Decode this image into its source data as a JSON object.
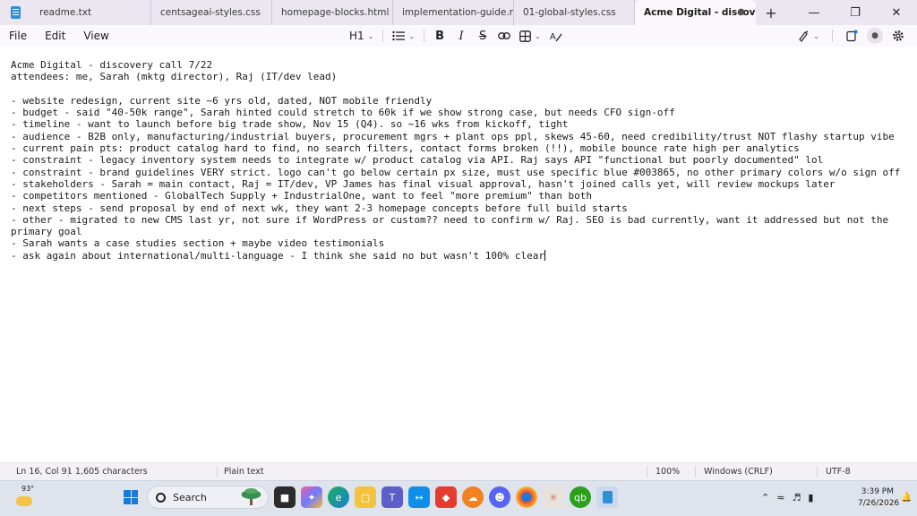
{
  "tabs": [
    {
      "label": "readme.txt",
      "active": false
    },
    {
      "label": "centsageai-styles.css",
      "active": false
    },
    {
      "label": "homepage-blocks.html",
      "active": false
    },
    {
      "label": "implementation-guide.md",
      "active": false
    },
    {
      "label": "01-global-styles.css",
      "active": false
    },
    {
      "label": "Acme Digital - discove",
      "active": true
    }
  ],
  "tab_modified_marker": "●",
  "new_tab_label": "+",
  "window_controls": {
    "minimize": "—",
    "maximize": "❐",
    "close": "✕"
  },
  "menu": {
    "file": "File",
    "edit": "Edit",
    "view": "View"
  },
  "toolbar": {
    "heading": "H1",
    "list_icon": "list-icon",
    "bold": "B",
    "italic": "I",
    "strikethrough": "S",
    "link_icon": "link-icon",
    "table_icon": "table-icon",
    "clear_format_icon": "clear-format-icon",
    "copilot_icon": "copilot-icon",
    "profile_icon": "profile-icon",
    "settings_icon": "gear-icon"
  },
  "document": {
    "lines": [
      "Acme Digital - discovery call 7/22",
      "attendees: me, Sarah (mktg director), Raj (IT/dev lead)",
      "",
      "- website redesign, current site ~6 yrs old, dated, NOT mobile friendly",
      "- budget - said \"40-50k range\", Sarah hinted could stretch to 60k if we show strong case, but needs CFO sign-off",
      "- timeline - want to launch before big trade show, Nov 15 (Q4). so ~16 wks from kickoff, tight",
      "- audience - B2B only, manufacturing/industrial buyers, procurement mgrs + plant ops ppl, skews 45-60, need credibility/trust NOT flashy startup vibe",
      "- current pain pts: product catalog hard to find, no search filters, contact forms broken (!!), mobile bounce rate high per analytics",
      "- constraint - legacy inventory system needs to integrate w/ product catalog via API. Raj says API \"functional but poorly documented\" lol",
      "- constraint - brand guidelines VERY strict. logo can't go below certain px size, must use specific blue #003865, no other primary colors w/o sign off",
      "- stakeholders - Sarah = main contact, Raj = IT/dev, VP James has final visual approval, hasn't joined calls yet, will review mockups later",
      "- competitors mentioned - GlobalTech Supply + IndustrialOne, want to feel \"more premium\" than both",
      "- next steps - send proposal by end of next wk, they want 2-3 homepage concepts before full build starts",
      "- other - migrated to new CMS last yr, not sure if WordPress or custom?? need to confirm w/ Raj. SEO is bad currently, want it addressed but not the primary goal",
      "- Sarah wants a case studies section + maybe video testimonials",
      "- ask again about international/multi-language - I think she said no but wasn't 100% clear"
    ]
  },
  "status": {
    "position": "Ln 16, Col 91",
    "characters": "1,605 characters",
    "format": "Plain text",
    "zoom": "100%",
    "line_endings": "Windows (CRLF)",
    "encoding": "UTF-8"
  },
  "taskbar": {
    "weather_temp": "93°",
    "search_label": "Search",
    "time": "3:39 PM",
    "date": "7/26/2026",
    "app_icons": [
      "file-explorer-icon",
      "edge-icon",
      "folder-icon",
      "teams-icon",
      "teamviewer-icon",
      "anydesk-icon",
      "cloud-icon",
      "discord-icon",
      "chrome-icon",
      "claude-icon",
      "quickbooks-icon",
      "notepad-icon"
    ]
  },
  "colors": {
    "accent": "#1b7ad6",
    "tabbar_bg": "#ebe6ef",
    "taskbar_bg": "#dfe3ec"
  }
}
